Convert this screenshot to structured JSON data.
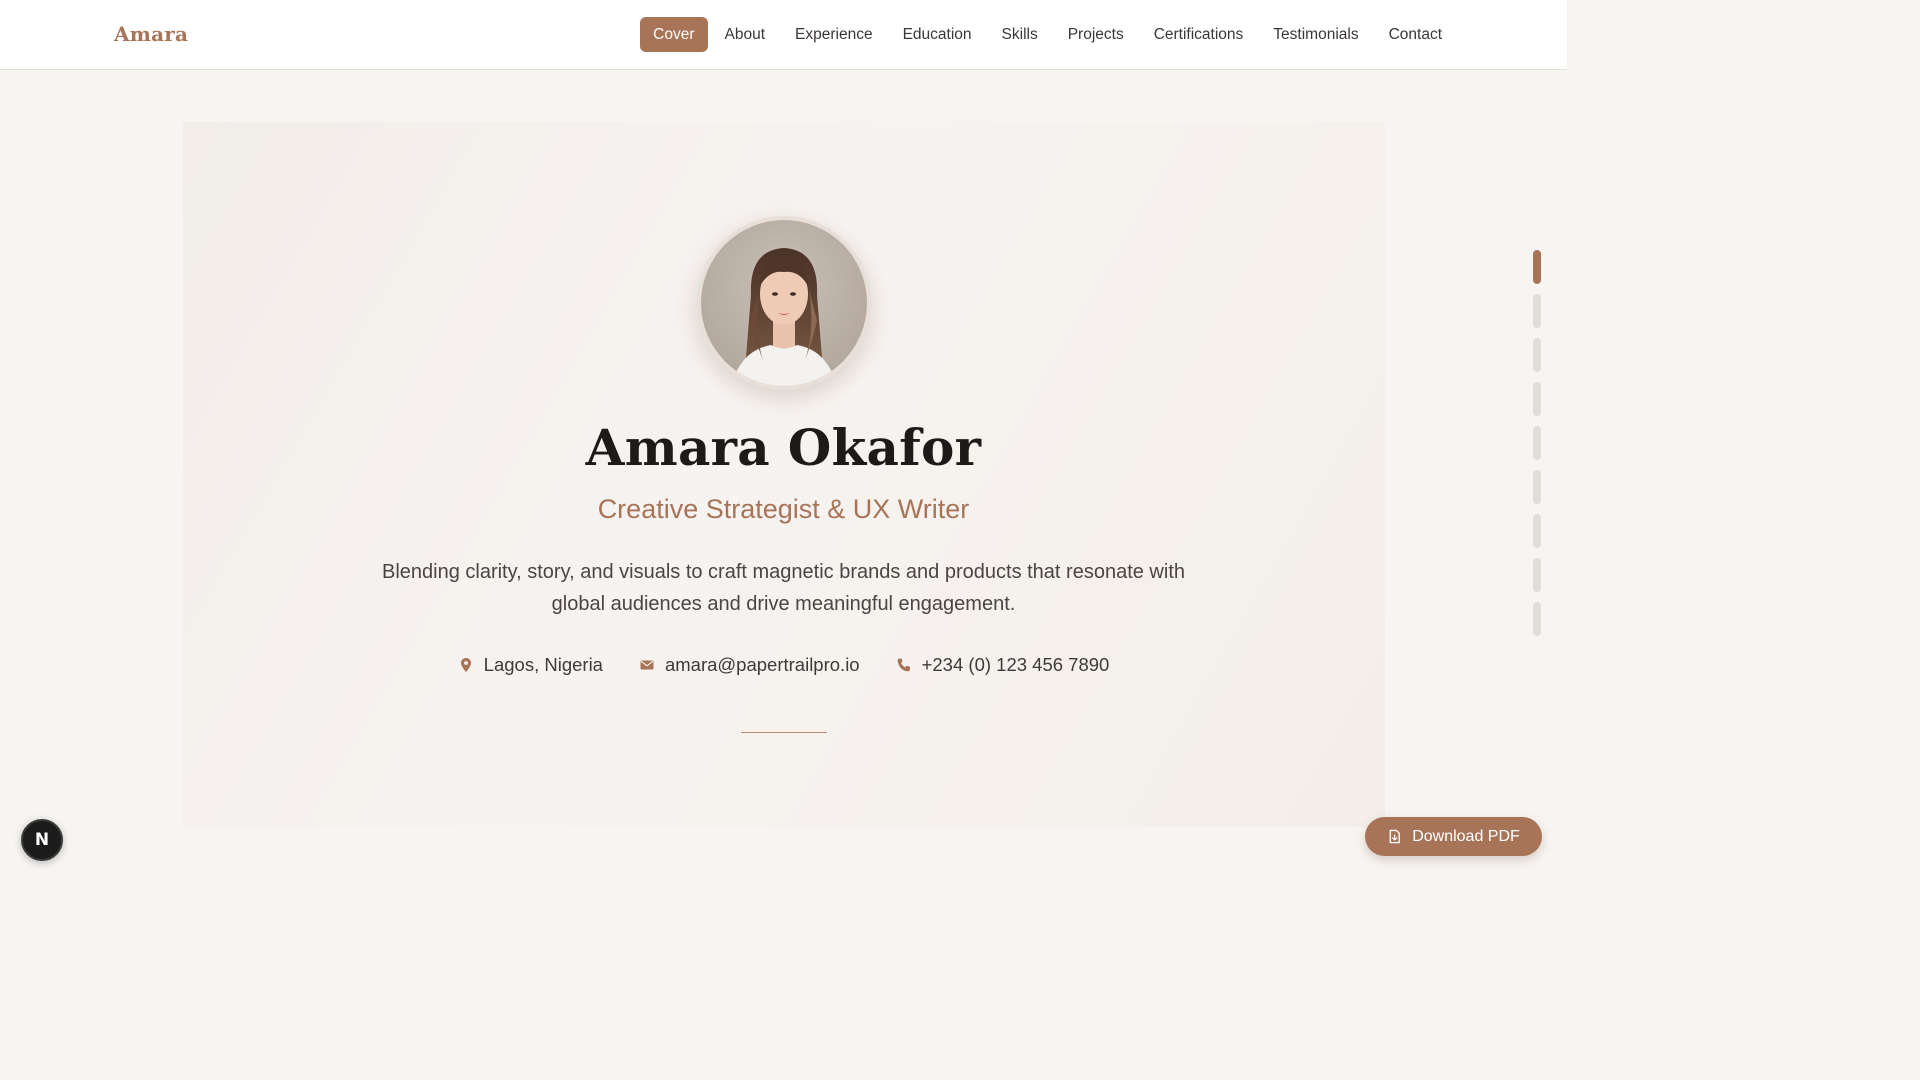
{
  "header": {
    "logo": "Amara",
    "nav": [
      {
        "label": "Cover",
        "active": true
      },
      {
        "label": "About"
      },
      {
        "label": "Experience"
      },
      {
        "label": "Education"
      },
      {
        "label": "Skills"
      },
      {
        "label": "Projects"
      },
      {
        "label": "Certifications"
      },
      {
        "label": "Testimonials"
      },
      {
        "label": "Contact"
      }
    ]
  },
  "hero": {
    "name": "Amara Okafor",
    "role": "Creative Strategist & UX Writer",
    "bio": "Blending clarity, story, and visuals to craft magnetic brands and products that resonate with global audiences and drive meaningful engagement.",
    "contacts": {
      "location": "Lagos, Nigeria",
      "email": "amara@papertrailpro.io",
      "phone": "+234 (0) 123 456 7890"
    }
  },
  "section_indicator": {
    "count": 9,
    "active_index": 0
  },
  "badge": {
    "letter": "N"
  },
  "actions": {
    "download_label": "Download PDF"
  },
  "icons": {
    "location": "map-pin-icon",
    "email": "envelope-icon",
    "phone": "phone-icon",
    "download": "document-icon"
  },
  "colors": {
    "accent": "#a87458",
    "background": "#f7f5f2",
    "heading": "#1e1a18"
  }
}
